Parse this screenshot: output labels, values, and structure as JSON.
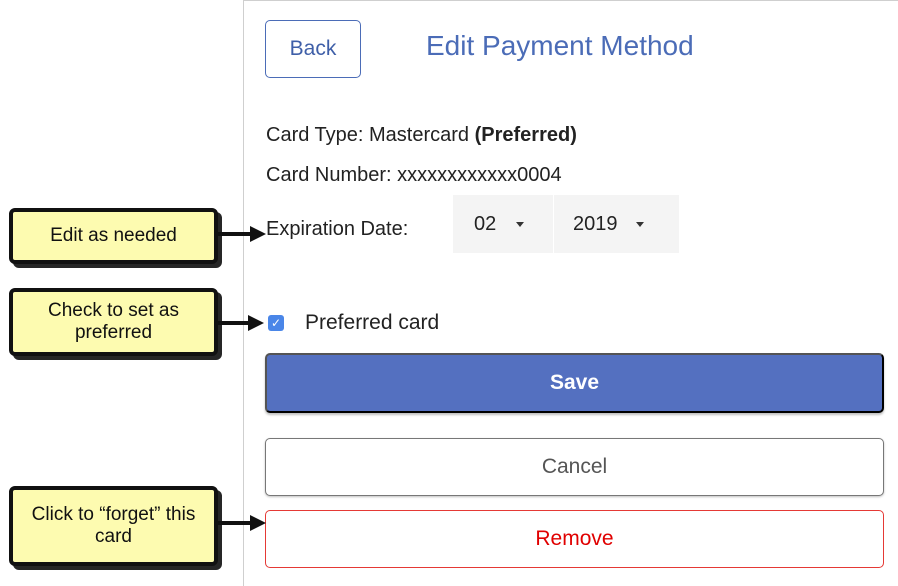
{
  "header": {
    "back_label": "Back",
    "title": "Edit Payment Method"
  },
  "card": {
    "type_prefix": "Card Type: Mastercard ",
    "type_preferred": "(Preferred)",
    "number_line": "Card Number: xxxxxxxxxxxx0004"
  },
  "expiration": {
    "label": "Expiration Date:",
    "month": "02",
    "year": "2019"
  },
  "preferred": {
    "checked": true,
    "label": "Preferred card"
  },
  "buttons": {
    "save": "Save",
    "cancel": "Cancel",
    "remove": "Remove"
  },
  "annotations": {
    "edit": "Edit as needed",
    "check": "Check to set as preferred",
    "forget": "Click to “forget” this card"
  },
  "colors": {
    "accent": "#4b6cb7",
    "save_bg": "#5470c0",
    "remove": "#e00000",
    "callout_bg": "#fdfbb0"
  }
}
